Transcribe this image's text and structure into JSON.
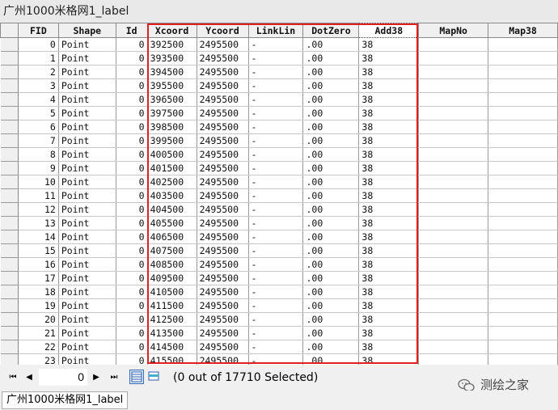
{
  "window": {
    "title": "广州1000米格网1_label"
  },
  "table": {
    "columns": [
      "FID",
      "Shape",
      "Id",
      "Xcoord",
      "Ycoord",
      "LinkLin",
      "DotZero",
      "Add38",
      "MapNo",
      "Map38"
    ],
    "rows": [
      [
        "0",
        "Point",
        "0",
        "392500",
        "2495500",
        "-",
        ".00",
        "38",
        "",
        ""
      ],
      [
        "1",
        "Point",
        "0",
        "393500",
        "2495500",
        "-",
        ".00",
        "38",
        "",
        ""
      ],
      [
        "2",
        "Point",
        "0",
        "394500",
        "2495500",
        "-",
        ".00",
        "38",
        "",
        ""
      ],
      [
        "3",
        "Point",
        "0",
        "395500",
        "2495500",
        "-",
        ".00",
        "38",
        "",
        ""
      ],
      [
        "4",
        "Point",
        "0",
        "396500",
        "2495500",
        "-",
        ".00",
        "38",
        "",
        ""
      ],
      [
        "5",
        "Point",
        "0",
        "397500",
        "2495500",
        "-",
        ".00",
        "38",
        "",
        ""
      ],
      [
        "6",
        "Point",
        "0",
        "398500",
        "2495500",
        "-",
        ".00",
        "38",
        "",
        ""
      ],
      [
        "7",
        "Point",
        "0",
        "399500",
        "2495500",
        "-",
        ".00",
        "38",
        "",
        ""
      ],
      [
        "8",
        "Point",
        "0",
        "400500",
        "2495500",
        "-",
        ".00",
        "38",
        "",
        ""
      ],
      [
        "9",
        "Point",
        "0",
        "401500",
        "2495500",
        "-",
        ".00",
        "38",
        "",
        ""
      ],
      [
        "10",
        "Point",
        "0",
        "402500",
        "2495500",
        "-",
        ".00",
        "38",
        "",
        ""
      ],
      [
        "11",
        "Point",
        "0",
        "403500",
        "2495500",
        "-",
        ".00",
        "38",
        "",
        ""
      ],
      [
        "12",
        "Point",
        "0",
        "404500",
        "2495500",
        "-",
        ".00",
        "38",
        "",
        ""
      ],
      [
        "13",
        "Point",
        "0",
        "405500",
        "2495500",
        "-",
        ".00",
        "38",
        "",
        ""
      ],
      [
        "14",
        "Point",
        "0",
        "406500",
        "2495500",
        "-",
        ".00",
        "38",
        "",
        ""
      ],
      [
        "15",
        "Point",
        "0",
        "407500",
        "2495500",
        "-",
        ".00",
        "38",
        "",
        ""
      ],
      [
        "16",
        "Point",
        "0",
        "408500",
        "2495500",
        "-",
        ".00",
        "38",
        "",
        ""
      ],
      [
        "17",
        "Point",
        "0",
        "409500",
        "2495500",
        "-",
        ".00",
        "38",
        "",
        ""
      ],
      [
        "18",
        "Point",
        "0",
        "410500",
        "2495500",
        "-",
        ".00",
        "38",
        "",
        ""
      ],
      [
        "19",
        "Point",
        "0",
        "411500",
        "2495500",
        "-",
        ".00",
        "38",
        "",
        ""
      ],
      [
        "20",
        "Point",
        "0",
        "412500",
        "2495500",
        "-",
        ".00",
        "38",
        "",
        ""
      ],
      [
        "21",
        "Point",
        "0",
        "413500",
        "2495500",
        "-",
        ".00",
        "38",
        "",
        ""
      ],
      [
        "22",
        "Point",
        "0",
        "414500",
        "2495500",
        "-",
        ".00",
        "38",
        "",
        ""
      ],
      [
        "23",
        "Point",
        "0",
        "415500",
        "2495500",
        "-",
        ".00",
        "38",
        "",
        ""
      ]
    ],
    "highlight_color": "#e02020"
  },
  "navigation": {
    "current_record": "0",
    "selection_status": "(0 out of 17710 Selected)"
  },
  "watermark": {
    "text": "测绘之家"
  },
  "tabs": [
    {
      "label": "广州1000米格网1_label"
    }
  ]
}
